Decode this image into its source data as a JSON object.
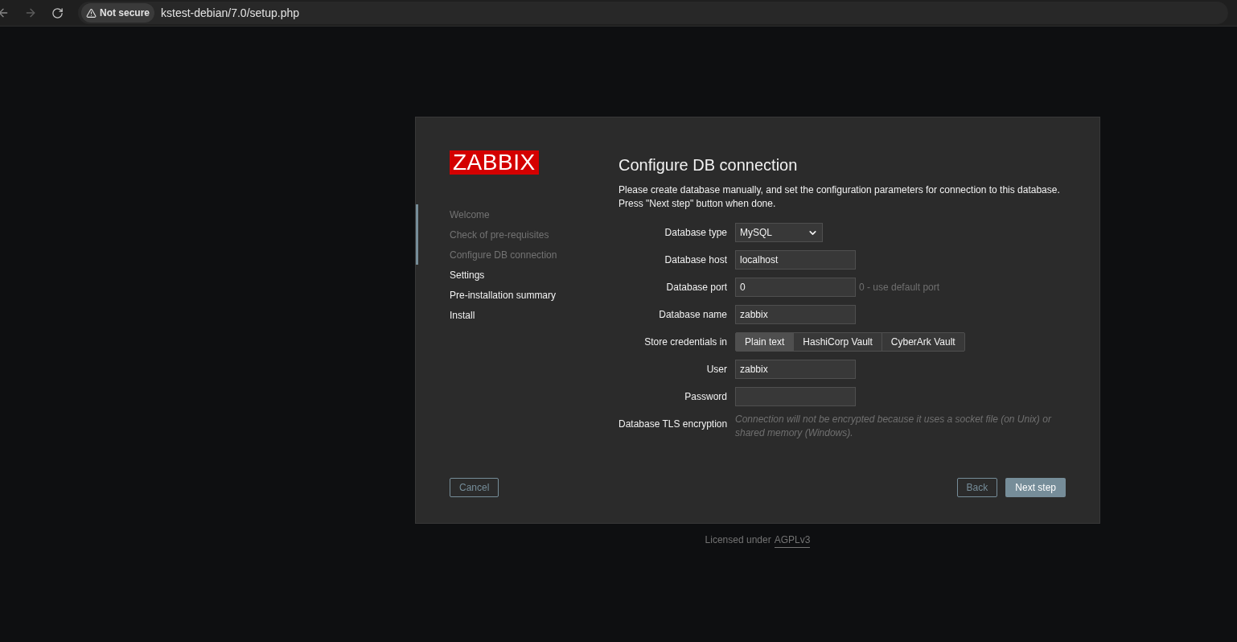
{
  "browser": {
    "security": "Not secure",
    "url": "kstest-debian/7.0/setup.php"
  },
  "logo": "ZABBIX",
  "steps": [
    {
      "label": "Welcome",
      "done": true
    },
    {
      "label": "Check of pre-requisites",
      "done": true
    },
    {
      "label": "Configure DB connection",
      "done": true
    },
    {
      "label": "Settings",
      "done": false
    },
    {
      "label": "Pre-installation summary",
      "done": false
    },
    {
      "label": "Install",
      "done": false
    }
  ],
  "title": "Configure DB connection",
  "intro": [
    "Please create database manually, and set the configuration parameters for connection to this database.",
    "Press \"Next step\" button when done."
  ],
  "fields": [
    {
      "kind": "select",
      "label": "Database type",
      "value": "MySQL"
    },
    {
      "kind": "input",
      "label": "Database host",
      "value": "localhost"
    },
    {
      "kind": "input",
      "label": "Database port",
      "value": "0",
      "hint": "0 - use default port"
    },
    {
      "kind": "input",
      "label": "Database name",
      "value": "zabbix"
    },
    {
      "kind": "segments",
      "label": "Store credentials in",
      "options": [
        {
          "label": "Plain text",
          "selected": true
        },
        {
          "label": "HashiCorp Vault",
          "selected": false
        },
        {
          "label": "CyberArk Vault",
          "selected": false
        }
      ]
    },
    {
      "kind": "input",
      "label": "User",
      "value": "zabbix"
    },
    {
      "kind": "password",
      "label": "Password"
    },
    {
      "kind": "note",
      "label": "Database TLS encryption",
      "text": "Connection will not be encrypted because it uses a socket file (on Unix) or shared memory (Windows)."
    }
  ],
  "buttons": {
    "cancel": "Cancel",
    "back": "Back",
    "next": "Next step"
  },
  "footer": {
    "text": "Licensed under",
    "link": "AGPLv3"
  }
}
